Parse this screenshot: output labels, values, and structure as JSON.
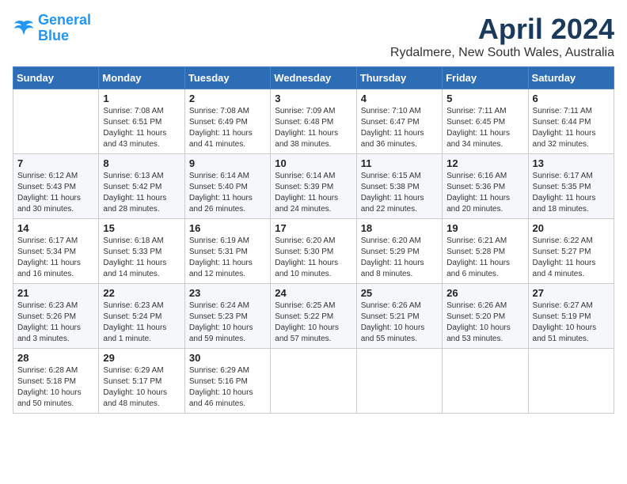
{
  "header": {
    "logo_line1": "General",
    "logo_line2": "Blue",
    "month": "April 2024",
    "location": "Rydalmere, New South Wales, Australia"
  },
  "days_of_week": [
    "Sunday",
    "Monday",
    "Tuesday",
    "Wednesday",
    "Thursday",
    "Friday",
    "Saturday"
  ],
  "weeks": [
    [
      {
        "day": "",
        "info": ""
      },
      {
        "day": "1",
        "info": "Sunrise: 7:08 AM\nSunset: 6:51 PM\nDaylight: 11 hours\nand 43 minutes."
      },
      {
        "day": "2",
        "info": "Sunrise: 7:08 AM\nSunset: 6:49 PM\nDaylight: 11 hours\nand 41 minutes."
      },
      {
        "day": "3",
        "info": "Sunrise: 7:09 AM\nSunset: 6:48 PM\nDaylight: 11 hours\nand 38 minutes."
      },
      {
        "day": "4",
        "info": "Sunrise: 7:10 AM\nSunset: 6:47 PM\nDaylight: 11 hours\nand 36 minutes."
      },
      {
        "day": "5",
        "info": "Sunrise: 7:11 AM\nSunset: 6:45 PM\nDaylight: 11 hours\nand 34 minutes."
      },
      {
        "day": "6",
        "info": "Sunrise: 7:11 AM\nSunset: 6:44 PM\nDaylight: 11 hours\nand 32 minutes."
      }
    ],
    [
      {
        "day": "7",
        "info": "Sunrise: 6:12 AM\nSunset: 5:43 PM\nDaylight: 11 hours\nand 30 minutes."
      },
      {
        "day": "8",
        "info": "Sunrise: 6:13 AM\nSunset: 5:42 PM\nDaylight: 11 hours\nand 28 minutes."
      },
      {
        "day": "9",
        "info": "Sunrise: 6:14 AM\nSunset: 5:40 PM\nDaylight: 11 hours\nand 26 minutes."
      },
      {
        "day": "10",
        "info": "Sunrise: 6:14 AM\nSunset: 5:39 PM\nDaylight: 11 hours\nand 24 minutes."
      },
      {
        "day": "11",
        "info": "Sunrise: 6:15 AM\nSunset: 5:38 PM\nDaylight: 11 hours\nand 22 minutes."
      },
      {
        "day": "12",
        "info": "Sunrise: 6:16 AM\nSunset: 5:36 PM\nDaylight: 11 hours\nand 20 minutes."
      },
      {
        "day": "13",
        "info": "Sunrise: 6:17 AM\nSunset: 5:35 PM\nDaylight: 11 hours\nand 18 minutes."
      }
    ],
    [
      {
        "day": "14",
        "info": "Sunrise: 6:17 AM\nSunset: 5:34 PM\nDaylight: 11 hours\nand 16 minutes."
      },
      {
        "day": "15",
        "info": "Sunrise: 6:18 AM\nSunset: 5:33 PM\nDaylight: 11 hours\nand 14 minutes."
      },
      {
        "day": "16",
        "info": "Sunrise: 6:19 AM\nSunset: 5:31 PM\nDaylight: 11 hours\nand 12 minutes."
      },
      {
        "day": "17",
        "info": "Sunrise: 6:20 AM\nSunset: 5:30 PM\nDaylight: 11 hours\nand 10 minutes."
      },
      {
        "day": "18",
        "info": "Sunrise: 6:20 AM\nSunset: 5:29 PM\nDaylight: 11 hours\nand 8 minutes."
      },
      {
        "day": "19",
        "info": "Sunrise: 6:21 AM\nSunset: 5:28 PM\nDaylight: 11 hours\nand 6 minutes."
      },
      {
        "day": "20",
        "info": "Sunrise: 6:22 AM\nSunset: 5:27 PM\nDaylight: 11 hours\nand 4 minutes."
      }
    ],
    [
      {
        "day": "21",
        "info": "Sunrise: 6:23 AM\nSunset: 5:26 PM\nDaylight: 11 hours\nand 3 minutes."
      },
      {
        "day": "22",
        "info": "Sunrise: 6:23 AM\nSunset: 5:24 PM\nDaylight: 11 hours\nand 1 minute."
      },
      {
        "day": "23",
        "info": "Sunrise: 6:24 AM\nSunset: 5:23 PM\nDaylight: 10 hours\nand 59 minutes."
      },
      {
        "day": "24",
        "info": "Sunrise: 6:25 AM\nSunset: 5:22 PM\nDaylight: 10 hours\nand 57 minutes."
      },
      {
        "day": "25",
        "info": "Sunrise: 6:26 AM\nSunset: 5:21 PM\nDaylight: 10 hours\nand 55 minutes."
      },
      {
        "day": "26",
        "info": "Sunrise: 6:26 AM\nSunset: 5:20 PM\nDaylight: 10 hours\nand 53 minutes."
      },
      {
        "day": "27",
        "info": "Sunrise: 6:27 AM\nSunset: 5:19 PM\nDaylight: 10 hours\nand 51 minutes."
      }
    ],
    [
      {
        "day": "28",
        "info": "Sunrise: 6:28 AM\nSunset: 5:18 PM\nDaylight: 10 hours\nand 50 minutes."
      },
      {
        "day": "29",
        "info": "Sunrise: 6:29 AM\nSunset: 5:17 PM\nDaylight: 10 hours\nand 48 minutes."
      },
      {
        "day": "30",
        "info": "Sunrise: 6:29 AM\nSunset: 5:16 PM\nDaylight: 10 hours\nand 46 minutes."
      },
      {
        "day": "",
        "info": ""
      },
      {
        "day": "",
        "info": ""
      },
      {
        "day": "",
        "info": ""
      },
      {
        "day": "",
        "info": ""
      }
    ]
  ]
}
